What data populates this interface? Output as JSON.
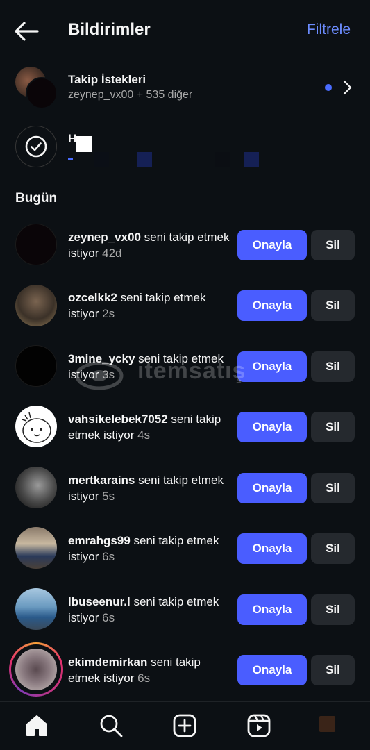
{
  "header": {
    "title": "Bildirimler",
    "filter_label": "Filtrele"
  },
  "follow_requests": {
    "title": "Takip İstekleri",
    "subtitle": "zeynep_vx00 + 535 diğer"
  },
  "check_row": {
    "text": "H"
  },
  "section_today": "Bugün",
  "requests": [
    {
      "user": "zeynep_vx00",
      "text": " seni takip etmek istiyor ",
      "time": "42d"
    },
    {
      "user": "ozcelkk2",
      "text": " seni takip etmek istiyor ",
      "time": "2s"
    },
    {
      "user": "3mine_ycky",
      "text": " seni takip etmek istiyor ",
      "time": "3s"
    },
    {
      "user": "vahsikelebek7052",
      "text": " seni takip etmek istiyor ",
      "time": "4s"
    },
    {
      "user": "mertkarains",
      "text": " seni takip etmek istiyor ",
      "time": "5s"
    },
    {
      "user": "emrahgs99",
      "text": " seni takip etmek istiyor ",
      "time": "6s"
    },
    {
      "user": "lbuseenur.l",
      "text": " seni takip etmek istiyor ",
      "time": "6s"
    },
    {
      "user": "ekimdemirkan",
      "text": " seni takip etmek istiyor ",
      "time": "6s"
    }
  ],
  "buttons": {
    "confirm": "Onayla",
    "delete": "Sil"
  },
  "watermark": "itemsatış",
  "nav": [
    "home-icon",
    "search-icon",
    "create-icon",
    "reels-icon",
    "profile-avatar"
  ],
  "colors": {
    "background": "#0c1014",
    "accent": "#4a5dff",
    "link": "#6c8cff",
    "secondary_button": "#25292e"
  }
}
